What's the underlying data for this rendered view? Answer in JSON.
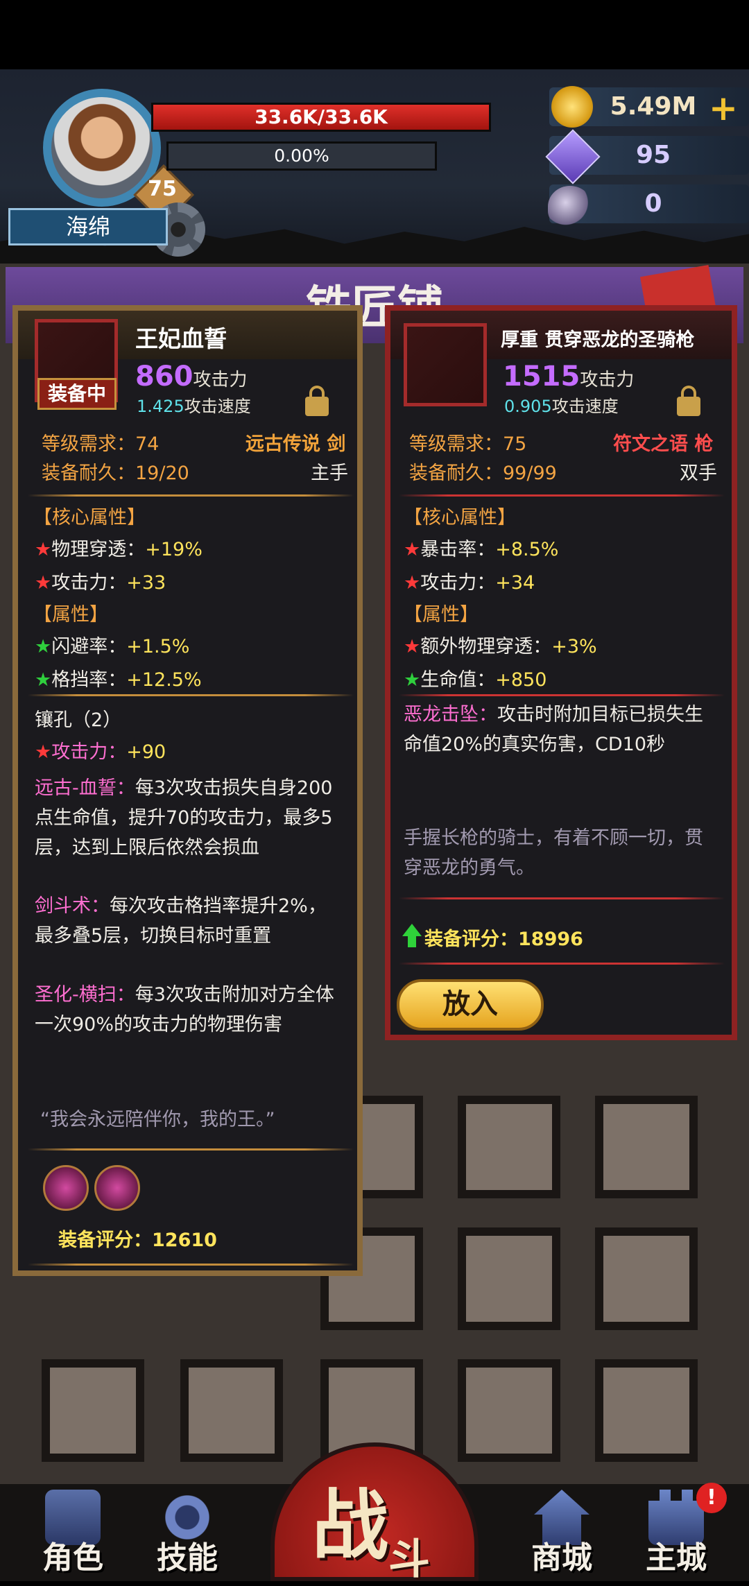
{
  "player": {
    "hp": "33.6K/33.6K",
    "exp": "0.00%",
    "level": "75",
    "name": "海绵"
  },
  "resources": {
    "gold": "5.49M",
    "gold_plus": "+",
    "crystals": "95",
    "horns": "0"
  },
  "shop": {
    "title": "铁匠铺"
  },
  "left_item": {
    "name": "王妃血誓",
    "equipped_badge": "装备中",
    "attack": "860",
    "attack_label": "攻击力",
    "speed": "1.425",
    "speed_label": "攻击速度",
    "req_label": "等级需求：74",
    "type_label": "远古传说 剑",
    "durability_label": "装备耐久：19/20",
    "hand_label": "主手",
    "core_header": "【核心属性】",
    "core_stats": [
      {
        "name": "物理穿透：",
        "value": "+19%"
      },
      {
        "name": "攻击力：",
        "value": "+33"
      }
    ],
    "attr_header": "【属性】",
    "attr_stats": [
      {
        "name": "闪避率：",
        "value": "+1.5%"
      },
      {
        "name": "格挡率：",
        "value": "+12.5%"
      }
    ],
    "socket_header": "镶孔（2）",
    "socket_stat": {
      "name": "攻击力：",
      "value": "+90"
    },
    "skills": [
      {
        "name": "远古-血誓：",
        "desc": "每3次攻击损失自身200点生命值，提升70的攻击力，最多5层，达到上限后依然会损血"
      },
      {
        "name": "剑斗术：",
        "desc": "每次攻击格挡率提升2%，最多叠5层，切换目标时重置"
      },
      {
        "name": "圣化-横扫：",
        "desc": "每3次攻击附加对方全体一次90%的攻击力的物理伤害"
      }
    ],
    "quote": "“我会永远陪伴你，我的王。”",
    "score_label": "装备评分：12610"
  },
  "right_item": {
    "name": "厚重 贯穿恶龙的圣骑枪",
    "attack": "1515",
    "attack_label": "攻击力",
    "speed": "0.905",
    "speed_label": "攻击速度",
    "req_label": "等级需求：75",
    "type_label": "符文之语 枪",
    "durability_label": "装备耐久：99/99",
    "hand_label": "双手",
    "core_header": "【核心属性】",
    "core_stats": [
      {
        "name": "暴击率：",
        "value": "+8.5%"
      },
      {
        "name": "攻击力：",
        "value": "+34"
      }
    ],
    "attr_header": "【属性】",
    "attr_stats": [
      {
        "name": "额外物理穿透：",
        "value": "+3%",
        "star": "red"
      },
      {
        "name": "生命值：",
        "value": "+850",
        "star": "green"
      }
    ],
    "skill": {
      "name": "恶龙击坠：",
      "desc": "攻击时附加目标已损失生命值20%的真实伤害，CD10秒"
    },
    "flavor": "手握长枪的骑士，有着不顾一切，贯穿恶龙的勇气。",
    "score_label": "装备评分：18996",
    "put_button": "放入"
  },
  "nav": {
    "character": "角色",
    "skills": "技能",
    "battle_big": "战",
    "battle_small": "斗",
    "store": "商城",
    "city": "主城",
    "alert": "!"
  }
}
